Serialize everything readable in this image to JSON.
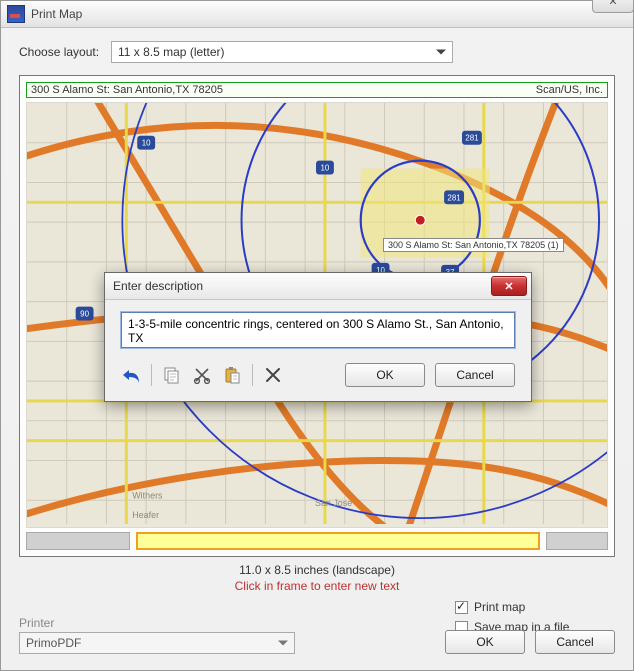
{
  "window": {
    "title": "Print Map",
    "close_glyph": "✕",
    "minmax_glyph": "—  □  ✕"
  },
  "layout": {
    "label": "Choose layout:",
    "selected": "11 x 8.5 map (letter)"
  },
  "map_header": {
    "left": "300 S Alamo St: San Antonio,TX 78205",
    "right": "Scan/US, Inc."
  },
  "site_label": "300 S Alamo St: San Antonio,TX 78205 (1)",
  "dimensions_text": "11.0 x 8.5 inches (landscape)",
  "hint_text": "Click in frame to enter new text",
  "printer": {
    "label": "Printer",
    "selected": "PrimoPDF"
  },
  "options": {
    "print_map_label": "Print map",
    "print_map_checked": true,
    "save_file_label": "Save map in a file",
    "save_file_checked": false
  },
  "buttons": {
    "ok": "OK",
    "cancel": "Cancel"
  },
  "modal": {
    "title": "Enter description",
    "text_value": "1-3-5-mile concentric rings, centered on 300 S Alamo St., San Antonio, TX",
    "ok": "OK",
    "cancel": "Cancel"
  },
  "icons": {
    "app": "app-icon",
    "undo": "undo-icon",
    "copy": "copy-icon",
    "cut": "cut-icon",
    "paste": "paste-icon",
    "delete": "delete-icon"
  }
}
